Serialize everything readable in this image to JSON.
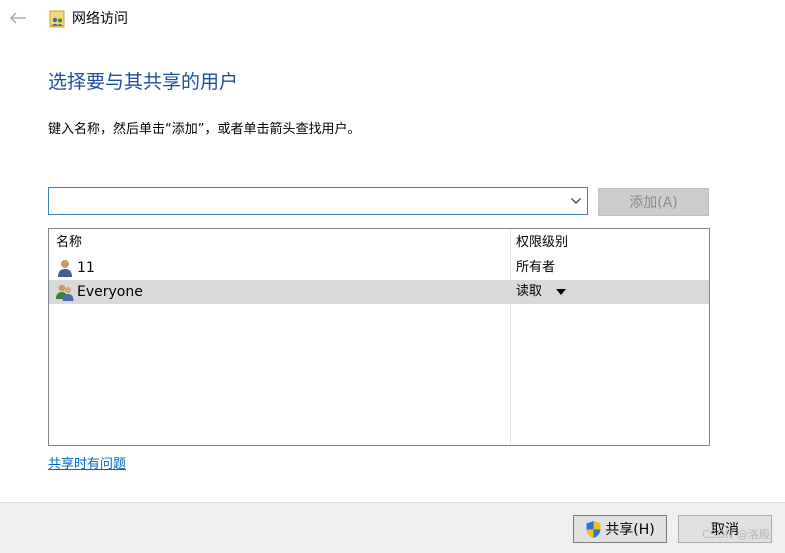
{
  "window": {
    "title": "网络访问",
    "title_icon": "network-share-folder-icon",
    "back_icon": "back-arrow-icon"
  },
  "main": {
    "heading": "选择要与其共享的用户",
    "instructions": "键入名称，然后单击“添加”，或者单击箭头查找用户。"
  },
  "search": {
    "value": "",
    "placeholder": "",
    "dropdown_icon": "chevron-down-icon",
    "add_label": "添加(A)",
    "add_enabled": false
  },
  "list": {
    "headers": {
      "name": "名称",
      "permission": "权限级别"
    },
    "rows": [
      {
        "name": "11",
        "permission": "所有者",
        "icon": "single-user-icon",
        "selected": false
      },
      {
        "name": "Everyone",
        "permission": "读取",
        "icon": "user-group-icon",
        "selected": true,
        "has_dropdown": true
      }
    ]
  },
  "links": {
    "help": "共享时有问题"
  },
  "footer": {
    "share_label": "共享(H)",
    "share_icon": "uac-shield-icon",
    "cancel_label": "取消"
  },
  "watermark": "CSDN @洛殿",
  "colors": {
    "heading": "#1f4e9c",
    "link": "#0066cc",
    "focus_border": "#3f7fc1",
    "selected_row": "#d9d9d9",
    "footer_bg": "#f0f0f0"
  }
}
